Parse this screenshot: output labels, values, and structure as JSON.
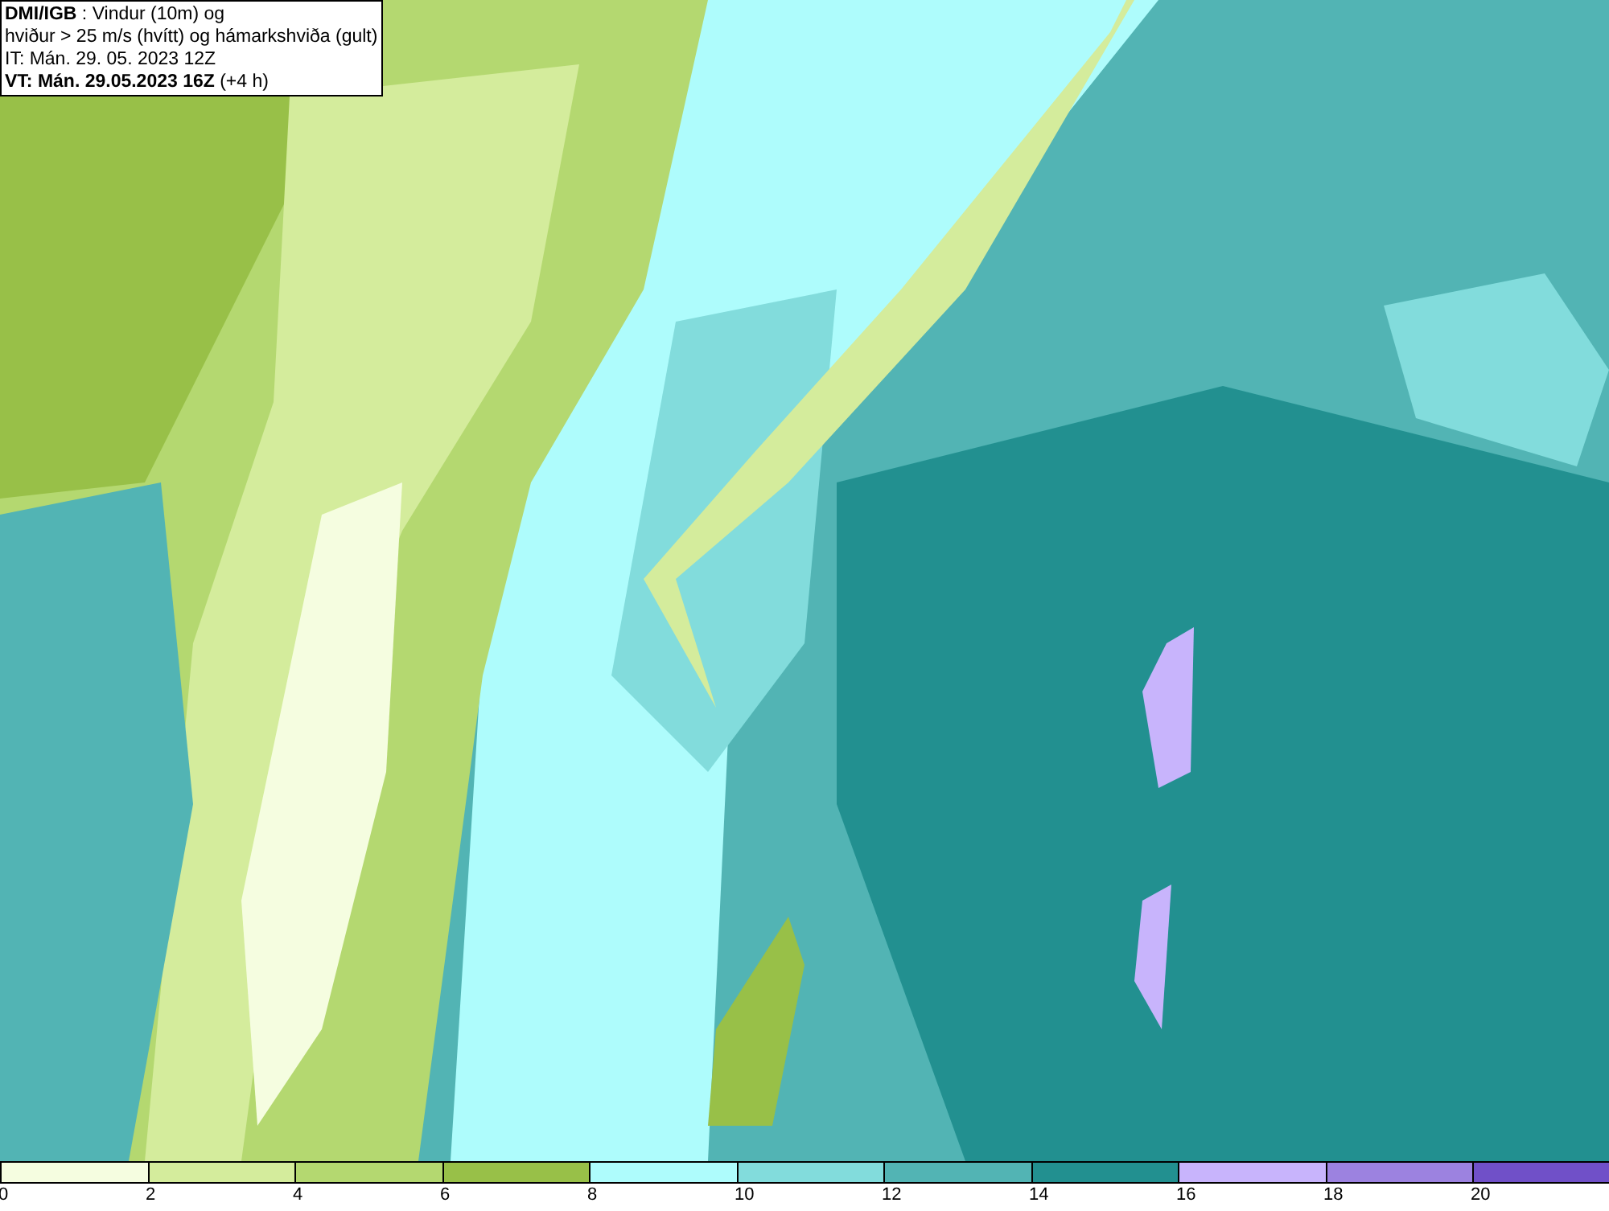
{
  "header": {
    "lines": [
      "**DMI/IGB** : Vindur (10m) og",
      "hviður > 25 m/s (hvítt) og hámarkshviða (gult)",
      "IT: Mán. 29. 05. 2023 12Z",
      "**VT: Mán. 29.05.2023 16Z** (+4 h)"
    ]
  },
  "legend": [
    {
      "label": "0",
      "color": "#f5fde0"
    },
    {
      "label": "2",
      "color": "#d4ec9c"
    },
    {
      "label": "4",
      "color": "#b4d870"
    },
    {
      "label": "6",
      "color": "#98c048"
    },
    {
      "label": "8",
      "color": "#aefcfc"
    },
    {
      "label": "10",
      "color": "#82dcdc"
    },
    {
      "label": "12",
      "color": "#52b4b4"
    },
    {
      "label": "14",
      "color": "#229090"
    },
    {
      "label": "16",
      "color": "#c8b4fc"
    },
    {
      "label": "18",
      "color": "#9c82e0"
    },
    {
      "label": "20",
      "color": "#7050c8"
    }
  ]
}
